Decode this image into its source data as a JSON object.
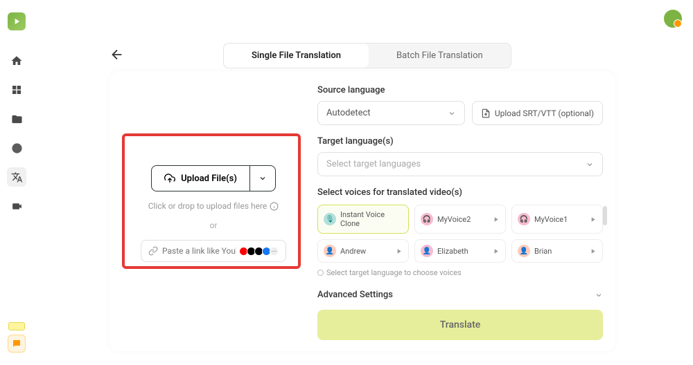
{
  "tabs": {
    "single": "Single File Translation",
    "batch": "Batch File Translation"
  },
  "upload": {
    "button_label": "Upload File(s)",
    "hint": "Click or drop to upload files here",
    "or": "or",
    "link_placeholder": "Paste a link like YouTube/Ti..."
  },
  "source": {
    "label": "Source language",
    "value": "Autodetect",
    "srt_label": "Upload SRT/VTT (optional)"
  },
  "target": {
    "label": "Target language(s)",
    "placeholder": "Select target languages"
  },
  "voices": {
    "label": "Select voices for translated video(s)",
    "items": [
      {
        "name": "Instant Voice Clone",
        "type": "mic",
        "highlighted": true
      },
      {
        "name": "MyVoice2",
        "type": "hp"
      },
      {
        "name": "MyVoice1",
        "type": "hp"
      },
      {
        "name": "Andrew",
        "type": "m1"
      },
      {
        "name": "Elizabeth",
        "type": "hp"
      },
      {
        "name": "Brian",
        "type": "m1"
      }
    ],
    "hint": "Select target language to choose voices"
  },
  "advanced": {
    "label": "Advanced Settings"
  },
  "translate_label": "Translate"
}
